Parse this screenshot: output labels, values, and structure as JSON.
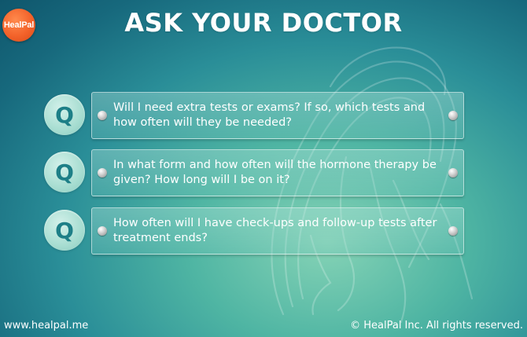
{
  "brand": {
    "logo_text": "HealPal",
    "accent_color": "#f3622a"
  },
  "header": {
    "title": "ASK YOUR DOCTOR"
  },
  "questions": [
    {
      "badge": "Q",
      "text": "Will I need extra tests or exams? If so, which tests and how often will they be needed?"
    },
    {
      "badge": "Q",
      "text": "In what form and how often will the hormone therapy be given? How long will I be on it?"
    },
    {
      "badge": "Q",
      "text": "How often will I have check-ups and follow-up tests after treatment ends?"
    }
  ],
  "footer": {
    "website": "www.healpal.me",
    "copyright": "© HealPal Inc. All rights reserved."
  }
}
